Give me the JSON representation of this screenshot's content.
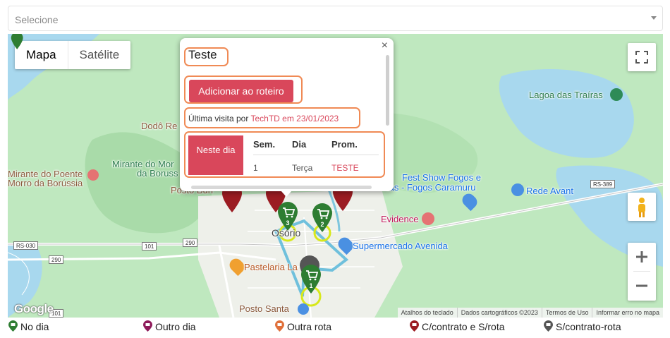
{
  "select": {
    "placeholder": "Selecione"
  },
  "map_type": {
    "map": "Mapa",
    "satellite": "Satélite"
  },
  "popup": {
    "title": "Teste",
    "add_button": "Adicionar ao roteiro",
    "visit_prefix": "Última visita por ",
    "visit_highlight": "TechTD em 23/01/2023",
    "close": "×",
    "badge": "Neste dia",
    "table": {
      "headers": [
        "Sem.",
        "Dia",
        "Prom."
      ],
      "rows": [
        [
          "1",
          "Terça",
          "TESTE"
        ]
      ]
    }
  },
  "map_labels": {
    "lagoa": "Lagoa das Traíras",
    "dodo": "Dodô Re",
    "mirante_poente": "Mirante do Poente",
    "morro": "Morro da Borússia",
    "mirante_mor": "Mirante do Mor",
    "da_boruss": "da Boruss",
    "posto_buri": "Posto Buri",
    "fest_show": "Fest Show Fogos e",
    "fogos_caramuru": "tas - Fogos Caramuru",
    "rede_avant": "Rede Avant",
    "evidence": "Evidence",
    "osorio": "Osório",
    "supermercado": "Supermercado Avenida",
    "pastelaria": "Pastelaria La",
    "posto_santa": "Posto Santa",
    "santa_sub": "Sa",
    "rs389": "RS-389",
    "rs030": "RS-030",
    "r101": "101",
    "r290a": "290",
    "r290b": "290",
    "r101b": "101"
  },
  "pins": {
    "p1": "1",
    "p2": "2",
    "p3": "3"
  },
  "attribution": {
    "google": "Google",
    "shortcuts": "Atalhos do teclado",
    "data": "Dados cartográficos ©2023",
    "terms": "Termos de Uso",
    "report": "Informar erro no mapa"
  },
  "legend": [
    {
      "label": "No dia",
      "color": "#2e7d32"
    },
    {
      "label": "Outro dia",
      "color": "#8e1a5a"
    },
    {
      "label": "Outra rota",
      "color": "#e0703a"
    },
    {
      "label": "C/contrato e S/rota",
      "color": "#9b1c22"
    },
    {
      "label": "S/contrato-rota",
      "color": "#555555"
    }
  ],
  "colors": {
    "accent": "#d9475b",
    "highlight": "#f08a55",
    "water": "#a8d8ee",
    "land": "#bfe8bf"
  }
}
